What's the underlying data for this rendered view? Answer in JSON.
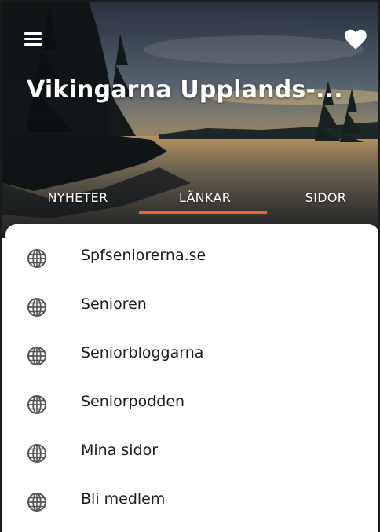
{
  "header": {
    "title": "Vikingarna Upplands-...",
    "menu_icon": "hamburger-menu-icon",
    "favorite_icon": "heart-icon"
  },
  "tabs": [
    {
      "label": "NYHETER",
      "active": false
    },
    {
      "label": "LÄNKAR",
      "active": true
    },
    {
      "label": "SIDOR",
      "active": false
    }
  ],
  "links": [
    {
      "label": "Spfseniorerna.se",
      "icon": "globe-icon"
    },
    {
      "label": "Senioren",
      "icon": "globe-icon"
    },
    {
      "label": "Seniorbloggarna",
      "icon": "globe-icon"
    },
    {
      "label": "Seniorpodden",
      "icon": "globe-icon"
    },
    {
      "label": "Mina sidor",
      "icon": "globe-icon"
    },
    {
      "label": "Bli medlem",
      "icon": "globe-icon"
    }
  ],
  "colors": {
    "accent": "#e8682d",
    "text": "#1d1d1d",
    "icon": "#555555",
    "header_text": "#ffffff"
  }
}
